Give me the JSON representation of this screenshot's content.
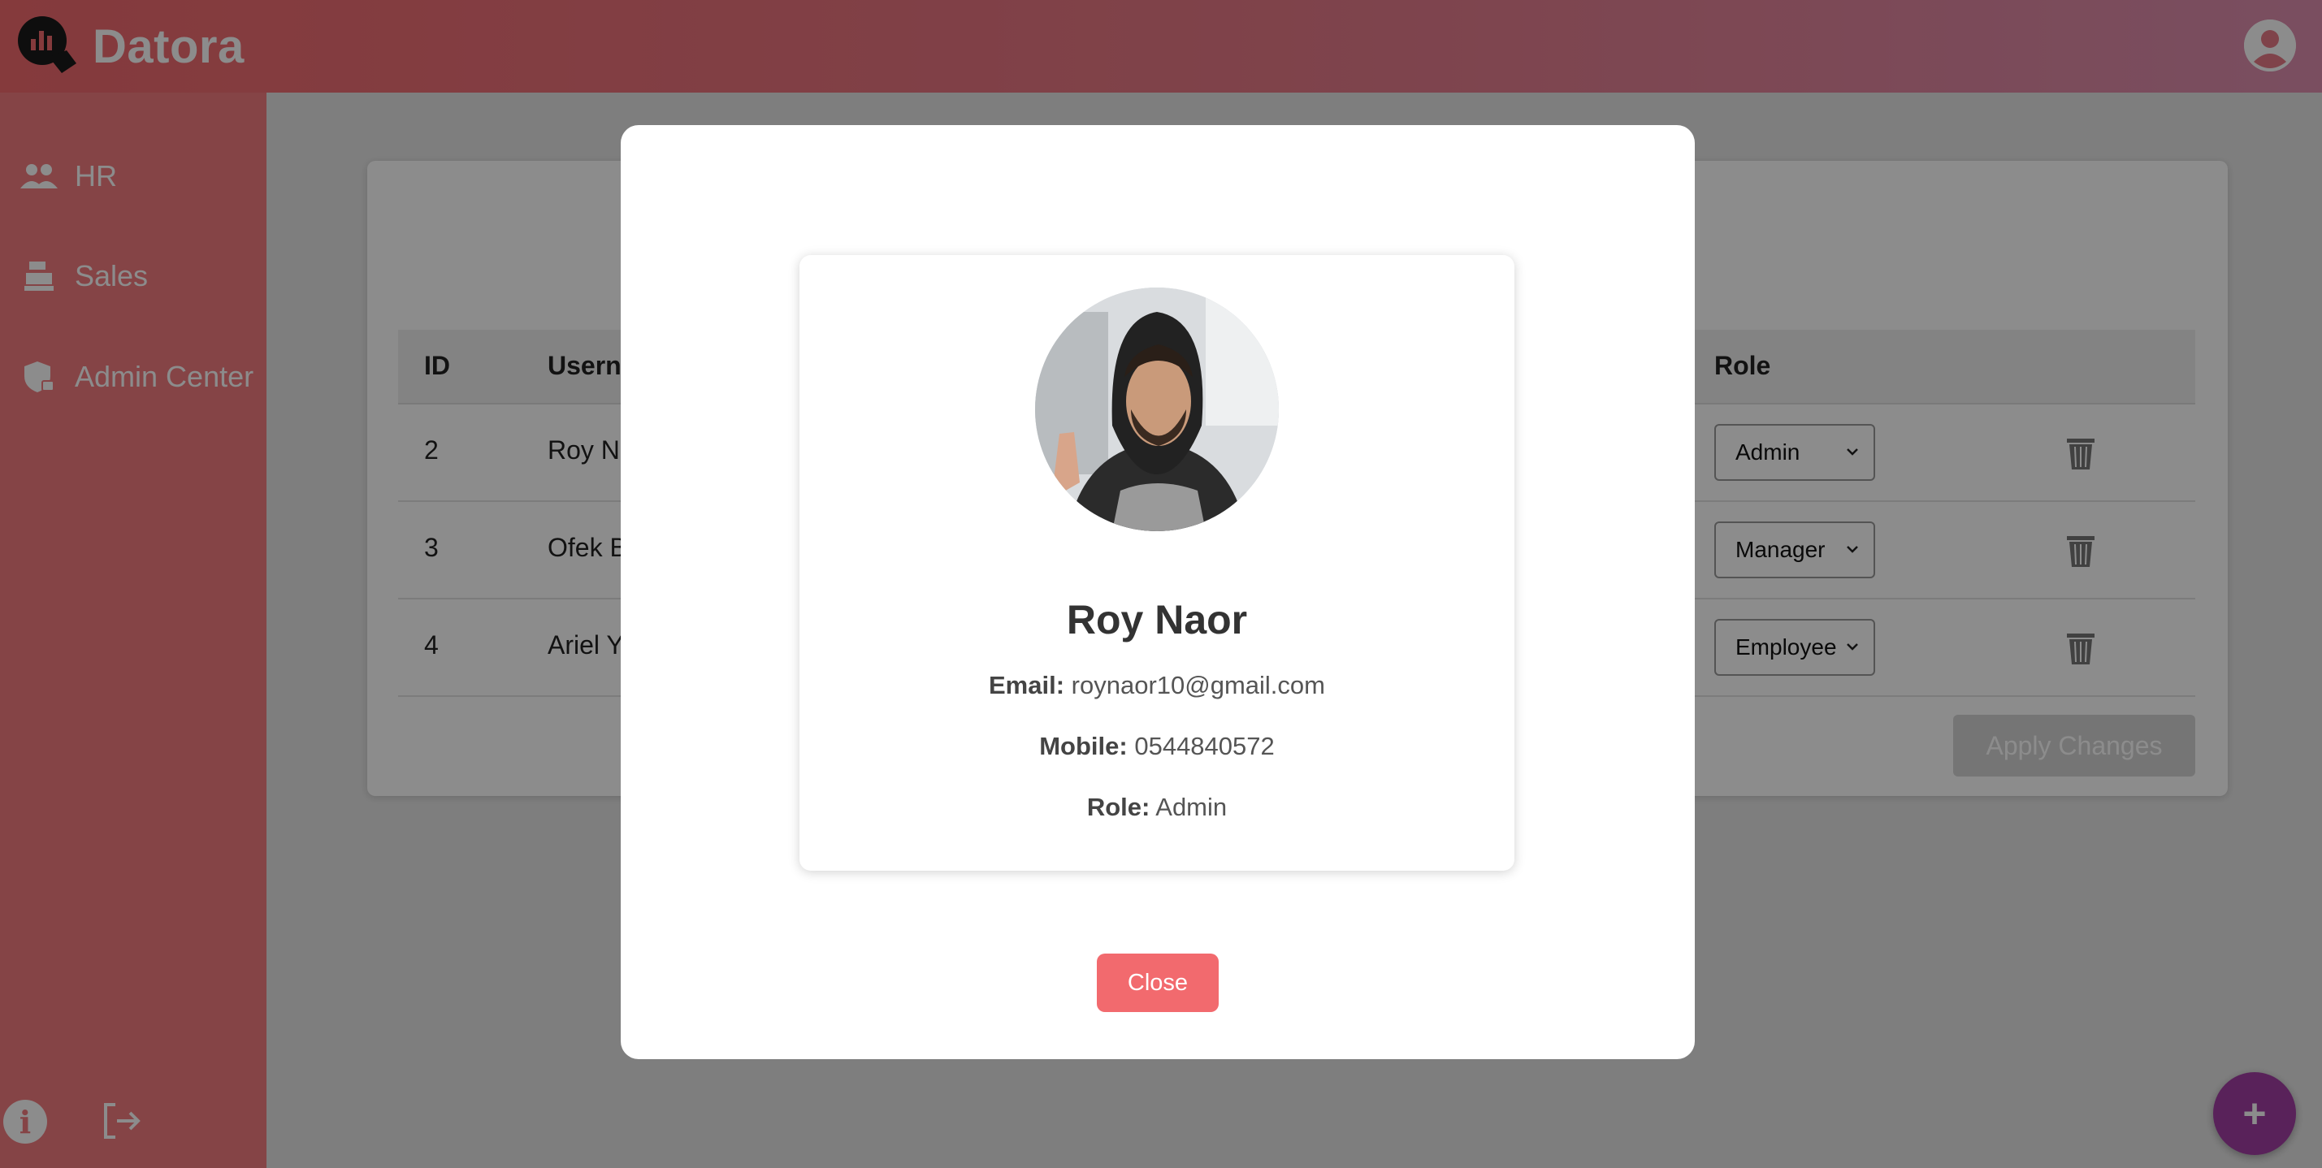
{
  "app": {
    "brand": "Datora"
  },
  "sidebar": {
    "items": [
      {
        "label": "HR",
        "icon": "people-icon"
      },
      {
        "label": "Sales",
        "icon": "cash-register-icon"
      },
      {
        "label": "Admin Center",
        "icon": "shield-lock-icon"
      }
    ]
  },
  "table": {
    "headers": {
      "id": "ID",
      "username": "Userna",
      "role": "Role"
    },
    "rows": [
      {
        "id": "2",
        "username": "Roy N",
        "role": "Admin"
      },
      {
        "id": "3",
        "username": "Ofek B",
        "role": "Manager"
      },
      {
        "id": "4",
        "username": "Ariel Y",
        "role": "Employee"
      }
    ],
    "apply_label": "Apply Changes"
  },
  "modal": {
    "name": "Roy Naor",
    "email_label": "Email:",
    "email": "roynaor10@gmail.com",
    "mobile_label": "Mobile:",
    "mobile": "0544840572",
    "role_label": "Role:",
    "role": "Admin",
    "close_label": "Close"
  },
  "fab": {
    "label": "+"
  },
  "colors": {
    "accent": "#f26a6e",
    "sidebar": "#f27c80",
    "fab": "#a23fa4"
  }
}
